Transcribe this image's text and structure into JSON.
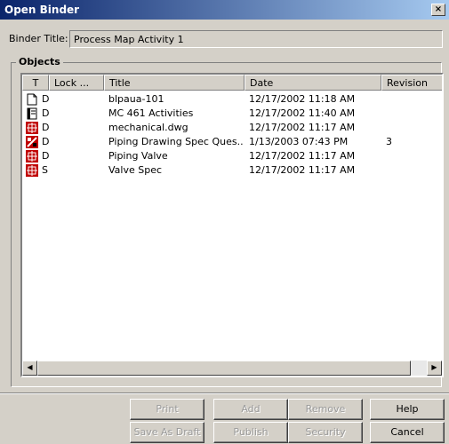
{
  "window": {
    "title": "Open Binder",
    "close_label": "×"
  },
  "binder": {
    "label": "Binder Title:",
    "value": "Process Map Activity 1"
  },
  "objects": {
    "legend": "Objects",
    "columns": [
      "T",
      "Lock ...",
      "Title",
      "Date",
      "Revision"
    ],
    "rows": [
      {
        "icon": "document-icon",
        "type": "D",
        "lock": "",
        "title": "blpaua-101",
        "date": "12/17/2002 11:18 AM",
        "revision": ""
      },
      {
        "icon": "notebook-icon",
        "type": "D",
        "lock": "",
        "title": "MC 461 Activities",
        "date": "12/17/2002 11:40 AM",
        "revision": ""
      },
      {
        "icon": "cad-drawing-icon",
        "type": "D",
        "lock": "",
        "title": "mechanical.dwg",
        "date": "12/17/2002 11:17 AM",
        "revision": ""
      },
      {
        "icon": "drawing-spec-icon",
        "type": "D",
        "lock": "",
        "title": "Piping Drawing Spec Ques...",
        "date": "1/13/2003 07:43 PM",
        "revision": "3"
      },
      {
        "icon": "cad-drawing-icon",
        "type": "D",
        "lock": "",
        "title": "Piping Valve",
        "date": "12/17/2002 11:17 AM",
        "revision": ""
      },
      {
        "icon": "cad-drawing-icon",
        "type": "S",
        "lock": "",
        "title": "Valve Spec",
        "date": "12/17/2002 11:17 AM",
        "revision": ""
      }
    ]
  },
  "buttons": {
    "print": "Print",
    "add": "Add",
    "remove": "Remove",
    "help": "Help",
    "save_as_draft": "Save As Draft",
    "publish": "Publish",
    "security": "Security",
    "cancel": "Cancel"
  },
  "scrollbar": {
    "left_arrow": "◀",
    "right_arrow": "▶"
  }
}
